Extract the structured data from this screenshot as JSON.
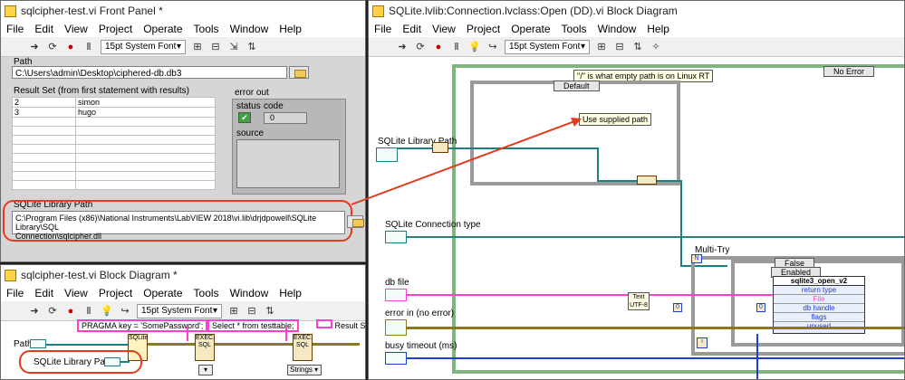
{
  "front_panel": {
    "title": "sqlcipher-test.vi Front Panel *",
    "menu": [
      "File",
      "Edit",
      "View",
      "Project",
      "Operate",
      "Tools",
      "Window",
      "Help"
    ],
    "font": "15pt System Font",
    "path_label": "Path",
    "path_value": "C:\\Users\\admin\\Desktop\\ciphered-db.db3",
    "result_label": "Result Set (from first statement with results)",
    "rows": [
      [
        "2",
        "simon"
      ],
      [
        "3",
        "hugo"
      ]
    ],
    "error_out_label": "error out",
    "status_label": "status",
    "code_label": "code",
    "code_value": "0",
    "source_label": "source",
    "sqlite_path_label": "SQLite Library Path",
    "sqlite_path_value_line1": "C:\\Program Files (x86)\\National Instruments\\LabVIEW 2018\\vi.lib\\drjdpowell\\SQLite Library\\SQL",
    "sqlite_path_value_line2": "Connection\\sqlcipher.dll"
  },
  "block_diagram": {
    "title": "sqlcipher-test.vi Block Diagram *",
    "menu": [
      "File",
      "Edit",
      "View",
      "Project",
      "Operate",
      "Tools",
      "Window",
      "Help"
    ],
    "font": "15pt System Font",
    "pragma": "PRAGMA key = 'SomePassword';",
    "select": "Select * from testtable;",
    "result_short": "Result Se",
    "path_label": "Path",
    "sqlite_label": "SQLite Library Path",
    "strings_label": "Strings",
    "node_sqlite": "SQLite",
    "node_exec": "EXEC. SQL"
  },
  "sqlite_open": {
    "title": "SQLite.lvlib:Connection.lvclass:Open (DD).vi Block Diagram",
    "menu": [
      "File",
      "Edit",
      "View",
      "Project",
      "Operate",
      "Tools",
      "Window",
      "Help"
    ],
    "font": "15pt System Font",
    "comment": "\"/\" is what empty path is on Linux RT",
    "case_default": "Default",
    "use_supplied": "Use supplied path",
    "no_error": "No Error",
    "sqlite_path_label": "SQLite Library Path",
    "conn_type_label": "SQLite Connection type",
    "db_file_label": "db file",
    "error_in_label": "error in (no error)",
    "busy_label": "busy timeout (ms)",
    "multi_try": "Multi-Try",
    "false_label": "False",
    "enabled_label": "Enabled",
    "fn_name": "sqlite3_open_v2",
    "fn_params": [
      "return type",
      "File",
      "db handle",
      "flags",
      "unused"
    ],
    "text_label": "Text",
    "utf8_label": "UTF-8",
    "zero": "0",
    "i_label": "i"
  }
}
